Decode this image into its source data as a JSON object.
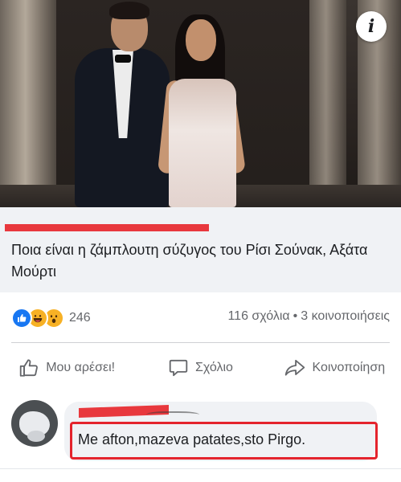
{
  "post": {
    "headline": "Ποια είναι η ζάμπλουτη σύζυγος του Ρίσι Σούνακ, Αξάτα Μούρτι"
  },
  "stats": {
    "reaction_icons": [
      "like-icon",
      "haha-icon",
      "wow-icon"
    ],
    "reaction_count": "246",
    "comments": "116 σχόλια",
    "separator": "•",
    "shares": "3 κοινοποιήσεις"
  },
  "actions": {
    "like": "Μου αρέσει!",
    "comment": "Σχόλιο",
    "share": "Κοινοποίηση"
  },
  "comment": {
    "text": "Me afton,mazeva  patates,sto Pirgo."
  },
  "colors": {
    "accent_blue": "#1877f2",
    "reaction_yellow": "#f7b125",
    "redaction_red": "#e8383d",
    "highlight_red": "#e4242d",
    "muted_text": "#65676b",
    "panel_bg": "#f0f2f5"
  }
}
